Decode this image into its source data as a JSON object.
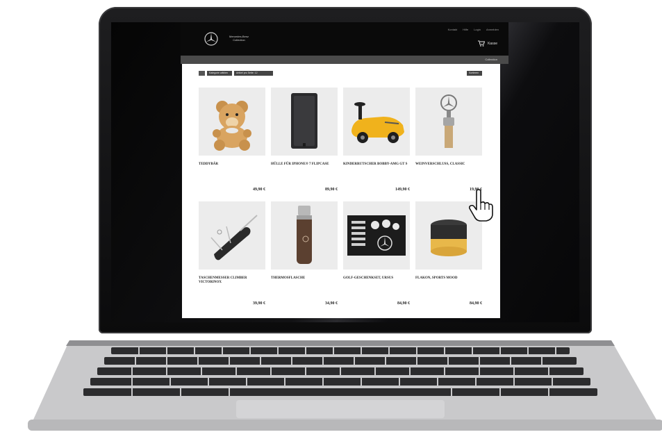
{
  "header": {
    "brand": "Mercedes-Benz",
    "brand_sub": "Collection",
    "top_links": [
      "Kontakt",
      "Hilfe",
      "Login",
      "Anmelden"
    ],
    "cart_label": "Kasse"
  },
  "nav": {
    "item": "Collection"
  },
  "filters": {
    "filter_1": "Kategorie wählen",
    "filter_2": "Artikel pro Seite: 12",
    "sort": "Sortieren"
  },
  "products": [
    {
      "name": "TEDDYBÄR",
      "price": "49,90 €",
      "icon": "teddy-bear"
    },
    {
      "name": "HÜLLE FÜR iPhone® 7 FLIPCASE",
      "price": "89,90 €",
      "icon": "phone-case"
    },
    {
      "name": "KINDERRUTSCHER BOBBY-AMG GT S",
      "price": "149,90 €",
      "icon": "toy-car"
    },
    {
      "name": "WEINVERSCHLUSS, CLASSIC",
      "price": "19,90 €",
      "icon": "wine-stopper"
    },
    {
      "name": "TASCHENMESSER CLIMBER VICTORINOX",
      "price": "39,90 €",
      "icon": "pocket-knife"
    },
    {
      "name": "THERMOSFLASCHE",
      "price": "34,90 €",
      "icon": "thermos"
    },
    {
      "name": "GOLF-GESCHENKSET, URSUS",
      "price": "84,90 €",
      "icon": "golf-set"
    },
    {
      "name": "FLAKON, SPORTS MOOD",
      "price": "84,90 €",
      "icon": "fragrance"
    }
  ]
}
